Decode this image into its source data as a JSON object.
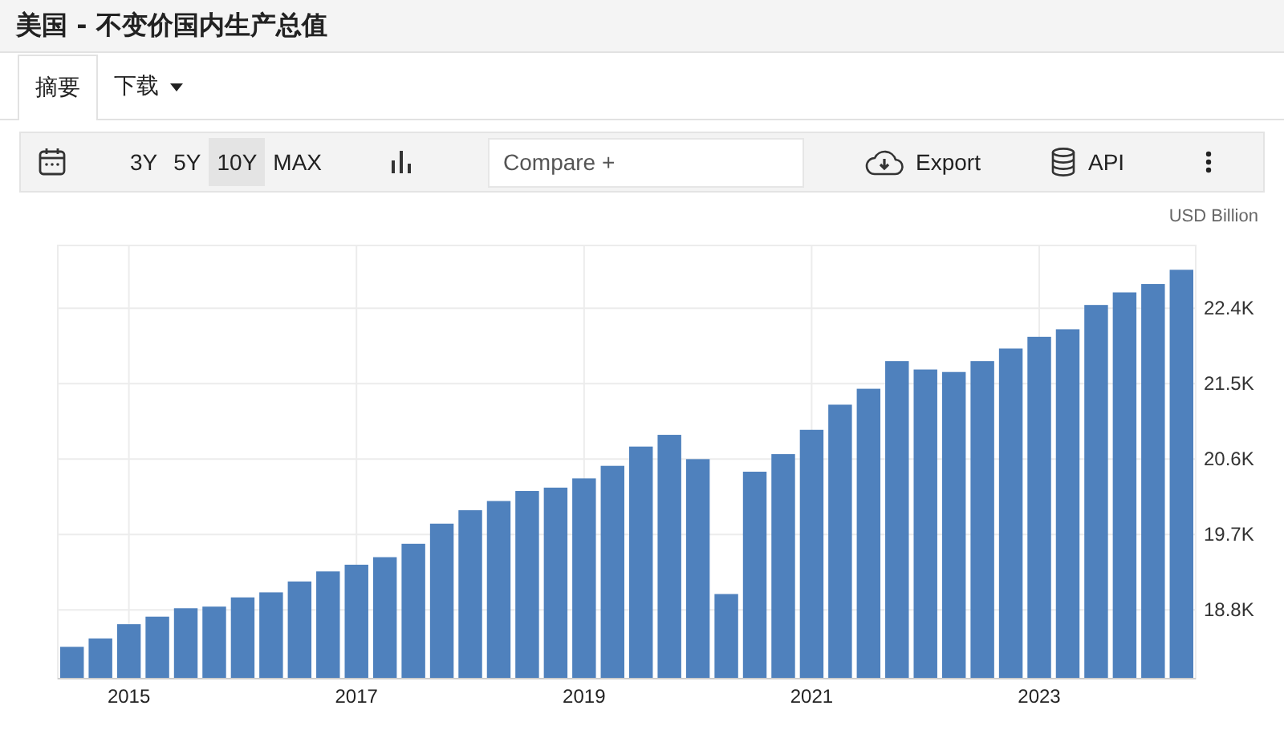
{
  "title": "美国 - 不变价国内生产总值",
  "tabs": [
    {
      "label": "摘要",
      "selected": true,
      "dropdown": false
    },
    {
      "label": "下载",
      "selected": false,
      "dropdown": true
    }
  ],
  "toolbar": {
    "ranges": [
      {
        "label": "3Y",
        "selected": false
      },
      {
        "label": "5Y",
        "selected": false
      },
      {
        "label": "10Y",
        "selected": true
      },
      {
        "label": "MAX",
        "selected": false
      }
    ],
    "compare": {
      "placeholder": "Compare +"
    },
    "export": "Export",
    "api": "API"
  },
  "unit": "USD Billion",
  "chart_data": {
    "type": "bar",
    "x": [
      2014.5,
      2014.75,
      2015,
      2015.25,
      2015.5,
      2015.75,
      2016,
      2016.25,
      2016.5,
      2016.75,
      2017,
      2017.25,
      2017.5,
      2017.75,
      2018,
      2018.25,
      2018.5,
      2018.75,
      2019,
      2019.25,
      2019.5,
      2019.75,
      2020,
      2020.25,
      2020.5,
      2020.75,
      2021,
      2021.25,
      2021.5,
      2021.75,
      2022,
      2022.25,
      2022.5,
      2022.75,
      2023,
      2023.25,
      2023.5,
      2023.75,
      2024,
      2024.25
    ],
    "grid": true,
    "xlim": [
      2014.375,
      2024.375
    ],
    "series": [
      {
        "color": "#4f81bd",
        "values": [
          18.36,
          18.46,
          18.63,
          18.72,
          18.82,
          18.84,
          18.95,
          19.01,
          19.14,
          19.26,
          19.34,
          19.43,
          19.59,
          19.83,
          19.99,
          20.1,
          20.22,
          20.26,
          20.37,
          20.52,
          20.75,
          20.89,
          20.6,
          18.99,
          20.45,
          20.66,
          20.95,
          21.25,
          21.44,
          21.77,
          21.67,
          21.64,
          21.77,
          21.92,
          22.06,
          22.15,
          22.44,
          22.59,
          22.69,
          22.86
        ]
      }
    ],
    "ylim": [
      17.98,
      23.15
    ],
    "yticks": [
      {
        "value": 18.8,
        "label": "18.8K"
      },
      {
        "value": 19.7,
        "label": "19.7K"
      },
      {
        "value": 20.6,
        "label": "20.6K"
      },
      {
        "value": 21.5,
        "label": "21.5K"
      },
      {
        "value": 22.4,
        "label": "22.4K"
      }
    ],
    "xticks": [
      2015,
      2017,
      2019,
      2021,
      2023
    ]
  }
}
